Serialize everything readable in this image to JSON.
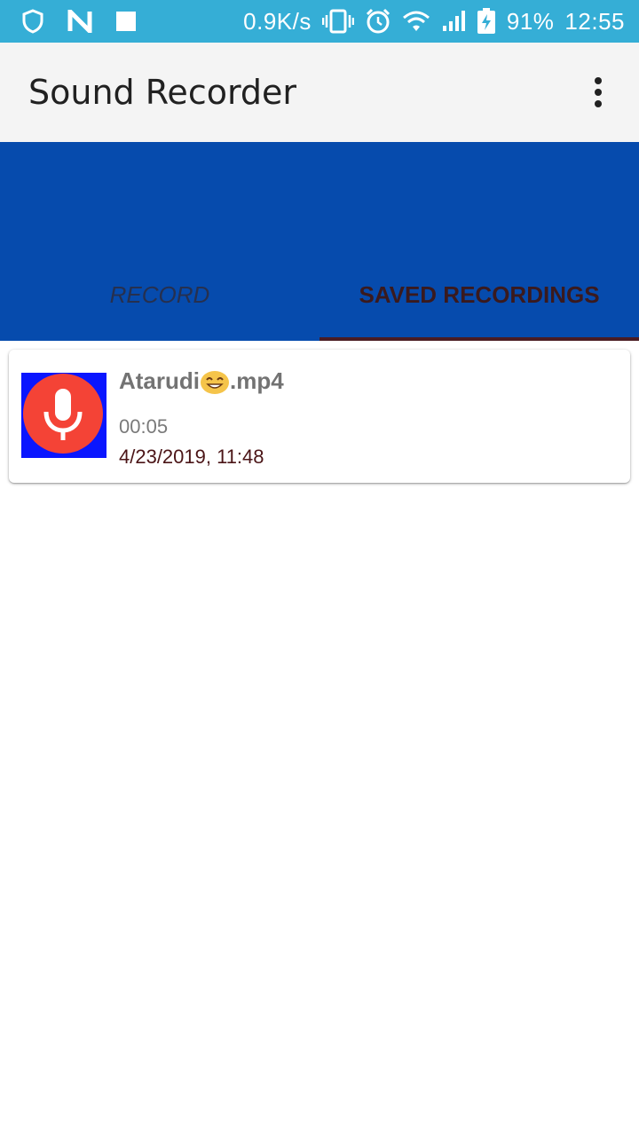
{
  "status_bar": {
    "net_speed": "0.9K/s",
    "battery": "91%",
    "time": "12:55",
    "icons": [
      "shield-icon",
      "n-icon",
      "square-icon",
      "vibrate-icon",
      "alarm-icon",
      "wifi-icon",
      "signal-icon",
      "battery-charging-icon"
    ],
    "background": "#35aed6"
  },
  "app_bar": {
    "title": "Sound Recorder",
    "overflow_icon": "more-vert-icon"
  },
  "tabs": {
    "background": "#064bad",
    "items": [
      {
        "label": "RECORD",
        "selected": false
      },
      {
        "label": "SAVED RECORDINGS",
        "selected": true
      }
    ]
  },
  "recordings": [
    {
      "name_prefix": "Atarudi",
      "name_emoji": "😊",
      "name_suffix": ".mp4",
      "duration": "00:05",
      "date": "4/23/2019, 11:48",
      "icon": "microphone-icon"
    }
  ],
  "colors": {
    "accent_red": "#f44336",
    "thumb_blue": "#0a16ff"
  }
}
